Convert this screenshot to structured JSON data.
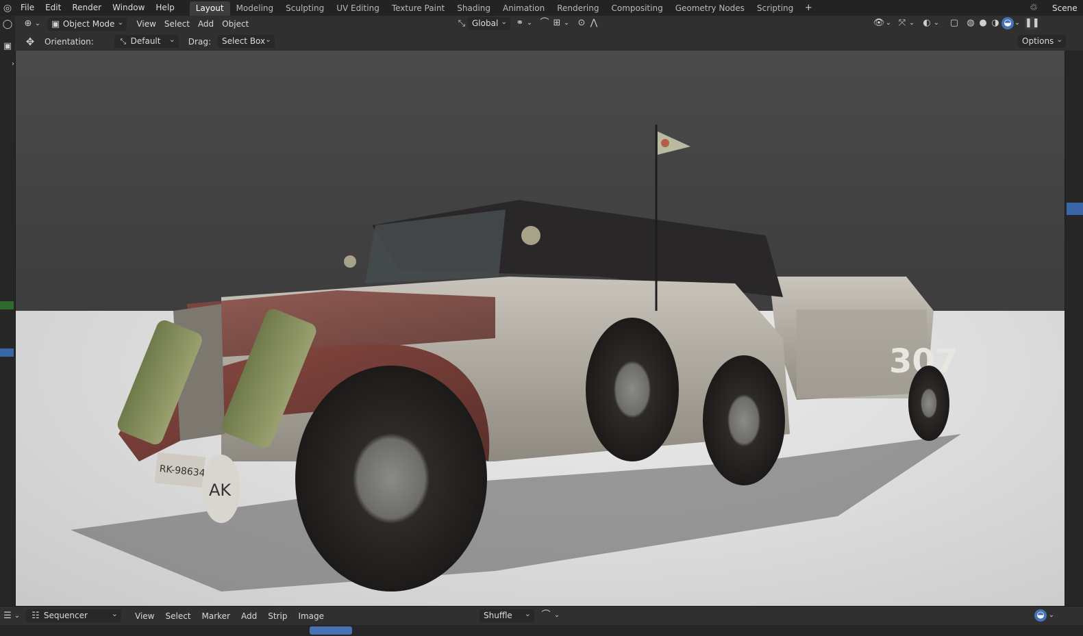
{
  "menu": [
    "File",
    "Edit",
    "Render",
    "Window",
    "Help"
  ],
  "workspaces": [
    "Layout",
    "Modeling",
    "Sculpting",
    "UV Editing",
    "Texture Paint",
    "Shading",
    "Animation",
    "Rendering",
    "Compositing",
    "Geometry Nodes",
    "Scripting"
  ],
  "active_workspace": "Layout",
  "scene_label": "Scene",
  "header": {
    "mode": "Object Mode",
    "menus": [
      "View",
      "Select",
      "Add",
      "Object"
    ],
    "transform_orientation": "Global"
  },
  "tool_settings": {
    "orientation_label": "Orientation:",
    "orientation_value": "Default",
    "drag_label": "Drag:",
    "drag_value": "Select Box",
    "options": "Options"
  },
  "viewport": {
    "trailer_number": "307",
    "plate_text": "RK-98634",
    "badge_text": "AK"
  },
  "sequencer": {
    "editor": "Sequencer",
    "menus": [
      "View",
      "Select",
      "Marker",
      "Add",
      "Strip",
      "Image"
    ],
    "mode": "Shuffle"
  },
  "colors": {
    "accent": "#4772b3",
    "active_tab": "#3d3d3d",
    "header_bg": "#303030",
    "topbar_bg": "#232323"
  }
}
